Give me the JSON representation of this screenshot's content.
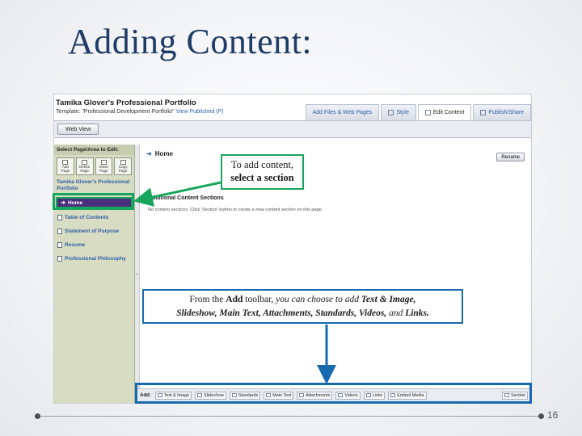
{
  "slide": {
    "title": "Adding Content:",
    "page_number": "16"
  },
  "app": {
    "portfolio_title": "Tamika Glover's Professional Portfolio",
    "template_label": "Template:",
    "template_value": "\"Professional Development Portfolio\"",
    "view_published": "View Published (P)",
    "tabs": [
      {
        "label": "Add Files & Web Pages",
        "active": false
      },
      {
        "label": "Style",
        "active": false
      },
      {
        "label": "Edit Content",
        "active": true
      },
      {
        "label": "Publish/Share",
        "active": false
      }
    ],
    "web_view_button": "Web View"
  },
  "sidebar": {
    "heading": "Select Page/Area to Edit:",
    "page_buttons": [
      {
        "line1": "Add",
        "line2": "Page"
      },
      {
        "line1": "Delete",
        "line2": "Page"
      },
      {
        "line1": "Move",
        "line2": "Page"
      },
      {
        "line1": "Copy",
        "line2": "Page"
      }
    ],
    "portfolio_name": "Tamika Glover's Professional Portfolio",
    "items": [
      {
        "label": "Home",
        "active": true
      },
      {
        "label": "Table of Contents",
        "active": false
      },
      {
        "label": "Statement of Purpose",
        "active": false
      },
      {
        "label": "Resume",
        "active": false
      },
      {
        "label": "Professional Philosophy",
        "active": false
      }
    ]
  },
  "main": {
    "page_title": "Home",
    "rename_button": "Rename",
    "sections_heading": "Additional Content Sections",
    "sections_note": "No content sections. Click 'Section' button to create a new content section on this page."
  },
  "add_toolbar": {
    "label": "Add:",
    "buttons": [
      "Text & Image",
      "Slideshow",
      "Standards",
      "Main Text",
      "Attachments",
      "Videos",
      "Links",
      "Embed Media"
    ],
    "section_button": "Section"
  },
  "callouts": {
    "top_line1": "To add content,",
    "top_line2": "select a section",
    "bottom_a": "From the",
    "bottom_b": "Add",
    "bottom_c": "toolbar,",
    "bottom_d": "you can choose to add",
    "bottom_e": "Text & Image,",
    "bottom_f": "Slideshow, Main Text, Attachments, Standards, Videos,",
    "bottom_g": "and",
    "bottom_h": "Links."
  },
  "colors": {
    "title": "#1f3b66",
    "green_highlight": "#18a55c",
    "blue_highlight": "#1769b0",
    "active_nav": "#4b2d7f",
    "sidebar_bg": "#d7dcc3"
  }
}
